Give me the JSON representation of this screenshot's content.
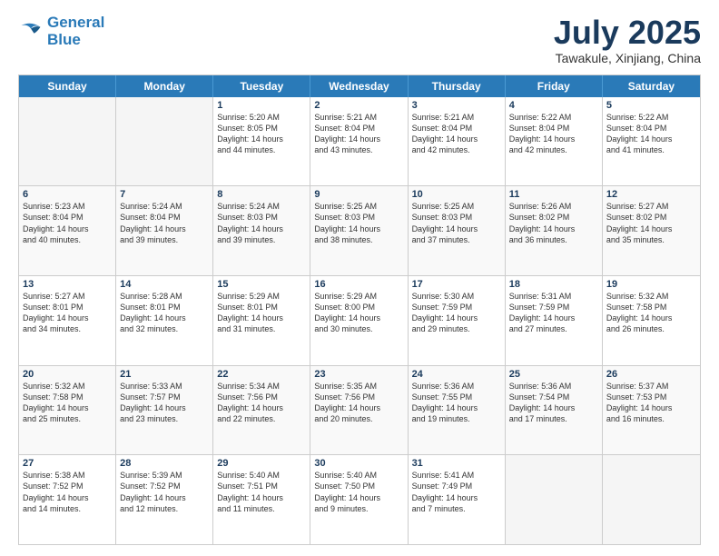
{
  "logo": {
    "line1": "General",
    "line2": "Blue"
  },
  "title": "July 2025",
  "location": "Tawakule, Xinjiang, China",
  "days_of_week": [
    "Sunday",
    "Monday",
    "Tuesday",
    "Wednesday",
    "Thursday",
    "Friday",
    "Saturday"
  ],
  "weeks": [
    [
      {
        "day": "",
        "text": ""
      },
      {
        "day": "",
        "text": ""
      },
      {
        "day": "1",
        "text": "Sunrise: 5:20 AM\nSunset: 8:05 PM\nDaylight: 14 hours\nand 44 minutes."
      },
      {
        "day": "2",
        "text": "Sunrise: 5:21 AM\nSunset: 8:04 PM\nDaylight: 14 hours\nand 43 minutes."
      },
      {
        "day": "3",
        "text": "Sunrise: 5:21 AM\nSunset: 8:04 PM\nDaylight: 14 hours\nand 42 minutes."
      },
      {
        "day": "4",
        "text": "Sunrise: 5:22 AM\nSunset: 8:04 PM\nDaylight: 14 hours\nand 42 minutes."
      },
      {
        "day": "5",
        "text": "Sunrise: 5:22 AM\nSunset: 8:04 PM\nDaylight: 14 hours\nand 41 minutes."
      }
    ],
    [
      {
        "day": "6",
        "text": "Sunrise: 5:23 AM\nSunset: 8:04 PM\nDaylight: 14 hours\nand 40 minutes."
      },
      {
        "day": "7",
        "text": "Sunrise: 5:24 AM\nSunset: 8:04 PM\nDaylight: 14 hours\nand 39 minutes."
      },
      {
        "day": "8",
        "text": "Sunrise: 5:24 AM\nSunset: 8:03 PM\nDaylight: 14 hours\nand 39 minutes."
      },
      {
        "day": "9",
        "text": "Sunrise: 5:25 AM\nSunset: 8:03 PM\nDaylight: 14 hours\nand 38 minutes."
      },
      {
        "day": "10",
        "text": "Sunrise: 5:25 AM\nSunset: 8:03 PM\nDaylight: 14 hours\nand 37 minutes."
      },
      {
        "day": "11",
        "text": "Sunrise: 5:26 AM\nSunset: 8:02 PM\nDaylight: 14 hours\nand 36 minutes."
      },
      {
        "day": "12",
        "text": "Sunrise: 5:27 AM\nSunset: 8:02 PM\nDaylight: 14 hours\nand 35 minutes."
      }
    ],
    [
      {
        "day": "13",
        "text": "Sunrise: 5:27 AM\nSunset: 8:01 PM\nDaylight: 14 hours\nand 34 minutes."
      },
      {
        "day": "14",
        "text": "Sunrise: 5:28 AM\nSunset: 8:01 PM\nDaylight: 14 hours\nand 32 minutes."
      },
      {
        "day": "15",
        "text": "Sunrise: 5:29 AM\nSunset: 8:01 PM\nDaylight: 14 hours\nand 31 minutes."
      },
      {
        "day": "16",
        "text": "Sunrise: 5:29 AM\nSunset: 8:00 PM\nDaylight: 14 hours\nand 30 minutes."
      },
      {
        "day": "17",
        "text": "Sunrise: 5:30 AM\nSunset: 7:59 PM\nDaylight: 14 hours\nand 29 minutes."
      },
      {
        "day": "18",
        "text": "Sunrise: 5:31 AM\nSunset: 7:59 PM\nDaylight: 14 hours\nand 27 minutes."
      },
      {
        "day": "19",
        "text": "Sunrise: 5:32 AM\nSunset: 7:58 PM\nDaylight: 14 hours\nand 26 minutes."
      }
    ],
    [
      {
        "day": "20",
        "text": "Sunrise: 5:32 AM\nSunset: 7:58 PM\nDaylight: 14 hours\nand 25 minutes."
      },
      {
        "day": "21",
        "text": "Sunrise: 5:33 AM\nSunset: 7:57 PM\nDaylight: 14 hours\nand 23 minutes."
      },
      {
        "day": "22",
        "text": "Sunrise: 5:34 AM\nSunset: 7:56 PM\nDaylight: 14 hours\nand 22 minutes."
      },
      {
        "day": "23",
        "text": "Sunrise: 5:35 AM\nSunset: 7:56 PM\nDaylight: 14 hours\nand 20 minutes."
      },
      {
        "day": "24",
        "text": "Sunrise: 5:36 AM\nSunset: 7:55 PM\nDaylight: 14 hours\nand 19 minutes."
      },
      {
        "day": "25",
        "text": "Sunrise: 5:36 AM\nSunset: 7:54 PM\nDaylight: 14 hours\nand 17 minutes."
      },
      {
        "day": "26",
        "text": "Sunrise: 5:37 AM\nSunset: 7:53 PM\nDaylight: 14 hours\nand 16 minutes."
      }
    ],
    [
      {
        "day": "27",
        "text": "Sunrise: 5:38 AM\nSunset: 7:52 PM\nDaylight: 14 hours\nand 14 minutes."
      },
      {
        "day": "28",
        "text": "Sunrise: 5:39 AM\nSunset: 7:52 PM\nDaylight: 14 hours\nand 12 minutes."
      },
      {
        "day": "29",
        "text": "Sunrise: 5:40 AM\nSunset: 7:51 PM\nDaylight: 14 hours\nand 11 minutes."
      },
      {
        "day": "30",
        "text": "Sunrise: 5:40 AM\nSunset: 7:50 PM\nDaylight: 14 hours\nand 9 minutes."
      },
      {
        "day": "31",
        "text": "Sunrise: 5:41 AM\nSunset: 7:49 PM\nDaylight: 14 hours\nand 7 minutes."
      },
      {
        "day": "",
        "text": ""
      },
      {
        "day": "",
        "text": ""
      }
    ]
  ]
}
